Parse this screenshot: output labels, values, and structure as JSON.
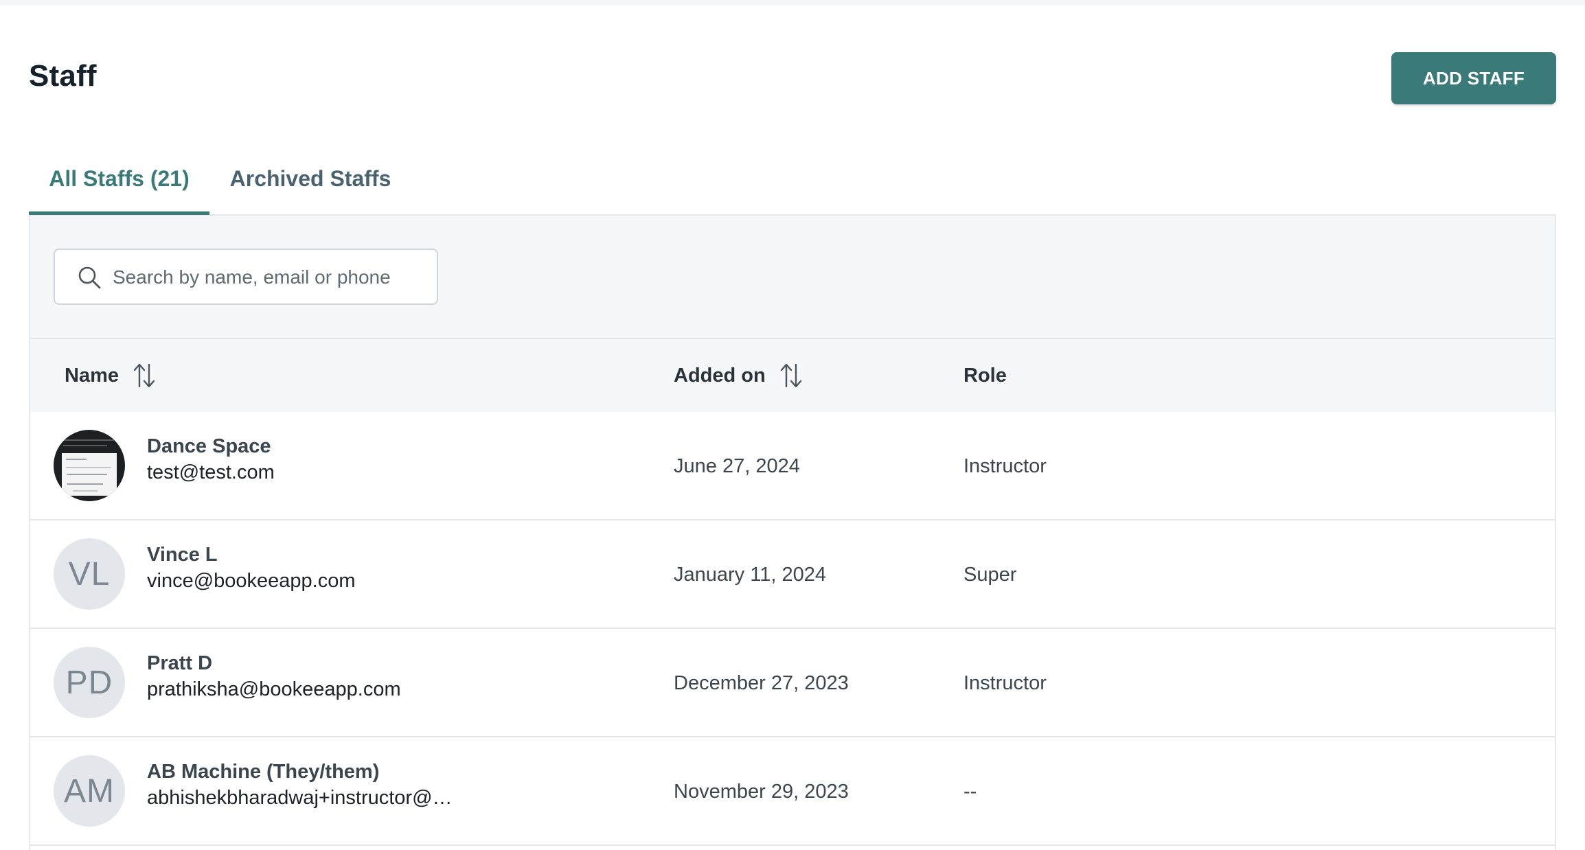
{
  "header": {
    "title": "Staff",
    "add_button_label": "ADD STAFF"
  },
  "tabs": [
    {
      "label": "All Staffs (21)",
      "active": true
    },
    {
      "label": "Archived Staffs",
      "active": false
    }
  ],
  "search": {
    "placeholder": "Search by name, email or phone",
    "value": "",
    "icon": "search-icon"
  },
  "table": {
    "columns": [
      {
        "label": "Name",
        "sortable": true
      },
      {
        "label": "Added on",
        "sortable": true
      },
      {
        "label": "Role",
        "sortable": false
      }
    ],
    "rows": [
      {
        "avatar_type": "photo",
        "initials": "",
        "name": "Dance Space",
        "email": "test@test.com",
        "added_on": "June 27, 2024",
        "role": "Instructor"
      },
      {
        "avatar_type": "initials",
        "initials": "VL",
        "name": "Vince L",
        "email": "vince@bookeeapp.com",
        "added_on": "January 11, 2024",
        "role": "Super"
      },
      {
        "avatar_type": "initials",
        "initials": "PD",
        "name": "Pratt D",
        "email": "prathiksha@bookeeapp.com",
        "added_on": "December 27, 2023",
        "role": "Instructor"
      },
      {
        "avatar_type": "initials",
        "initials": "AM",
        "name": "AB Machine (They/them)",
        "email": "abhishekbharadwaj+instructor@bo...",
        "added_on": "November 29, 2023",
        "role": "--"
      }
    ]
  },
  "colors": {
    "accent": "#3a7b7a",
    "tab_inactive": "#4a6270",
    "avatar_bg": "#e3e7ec",
    "table_header_bg": "#f6f7f9"
  }
}
